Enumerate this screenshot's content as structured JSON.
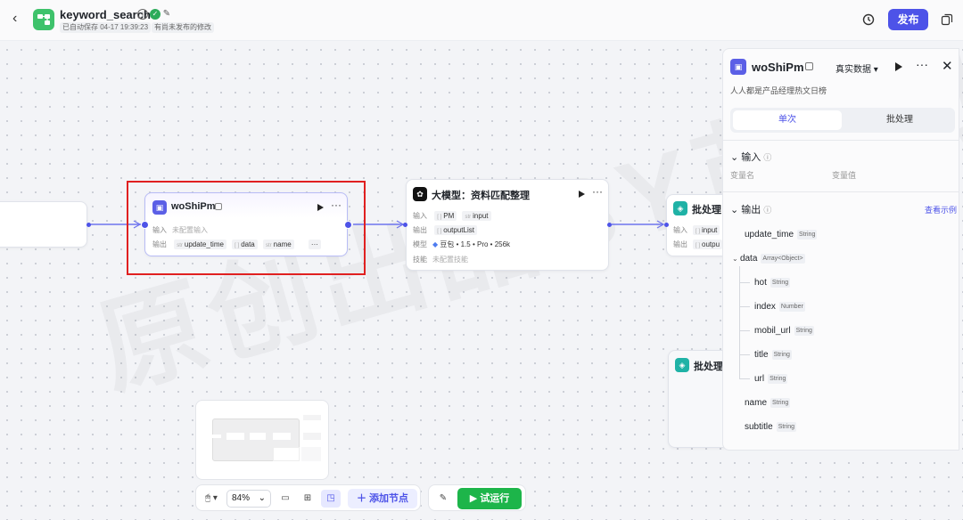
{
  "header": {
    "title": "keyword_search",
    "autosave": "已自动保存 04-17 19:39:23",
    "unpublished": "有尚未发布的修改",
    "publish": "发布"
  },
  "watermark": "原创出品BY苗伍杰",
  "nodes": {
    "wo": {
      "title": "woShiPm",
      "input_label": "输入",
      "input_value": "未配置输入",
      "output_label": "输出",
      "outputs": [
        {
          "type": "str",
          "name": "update_time"
        },
        {
          "type": "[ ]",
          "name": "data"
        },
        {
          "type": "str",
          "name": "name"
        }
      ]
    },
    "llm": {
      "title": "大模型：资料匹配整理",
      "rows": [
        {
          "label": "输入",
          "chips": [
            {
              "type": "[ ]",
              "name": "PM"
            },
            {
              "type": "str",
              "name": "input"
            }
          ]
        },
        {
          "label": "输出",
          "chips": [
            {
              "type": "[ ]",
              "name": "outputList"
            }
          ]
        }
      ],
      "model_label": "模型",
      "model_value": "豆包 • 1.5 • Pro • 256k",
      "skill_label": "技能",
      "skill_value": "未配置技能"
    },
    "batch": {
      "title": "批处理",
      "input_label": "输入",
      "input_chip": "input",
      "output_label": "输出",
      "output_chip": "outpu"
    },
    "batch2": {
      "title": "批处理"
    }
  },
  "toolbar": {
    "zoom": "84%",
    "add_node": "添加节点",
    "try_run": "试运行"
  },
  "panel": {
    "title": "woShiPm",
    "data_source": "真实数据",
    "description": "人人都是产品经理热文日榜",
    "tab_single": "单次",
    "tab_batch": "批处理",
    "input_section": "输入",
    "var_name": "变量名",
    "var_value": "变量值",
    "output_section": "输出",
    "view_example": "查看示例",
    "outputs": [
      {
        "name": "update_time",
        "type": "String"
      },
      {
        "name": "data",
        "type": "Array<Object>"
      },
      {
        "name": "hot",
        "type": "String"
      },
      {
        "name": "index",
        "type": "Number"
      },
      {
        "name": "mobil_url",
        "type": "String"
      },
      {
        "name": "title",
        "type": "String"
      },
      {
        "name": "url",
        "type": "String"
      },
      {
        "name": "name",
        "type": "String"
      },
      {
        "name": "subtitle",
        "type": "String"
      }
    ]
  },
  "colors": {
    "accent": "#4d53e8",
    "run": "#1db54a",
    "highlight": "#e02020",
    "logo": "#3ec26b"
  }
}
